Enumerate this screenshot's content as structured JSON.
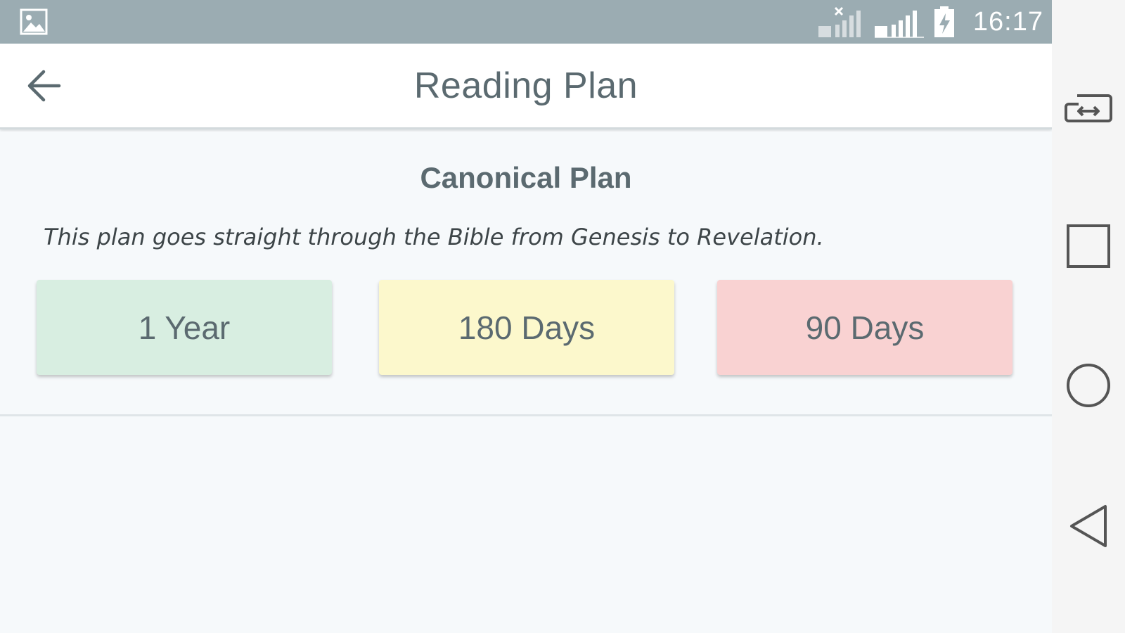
{
  "status_bar": {
    "time": "16:17",
    "icons": [
      "gallery-icon",
      "signal-no-service-icon",
      "signal-2g-icon",
      "battery-charging-icon"
    ],
    "background": "#9bacb2"
  },
  "app_bar": {
    "title": "Reading Plan",
    "back_icon": "arrow-left-icon"
  },
  "plan": {
    "title": "Canonical Plan",
    "description": "This plan goes straight through the Bible from Genesis to Revelation.",
    "options": [
      {
        "label": "1 Year",
        "color": "#d8eee1"
      },
      {
        "label": "180 Days",
        "color": "#fcf8cc"
      },
      {
        "label": "90 Days",
        "color": "#f9d2d2"
      }
    ]
  },
  "nav_bar": {
    "items": [
      "screen-switch-icon",
      "recents-icon",
      "home-icon",
      "back-icon"
    ]
  }
}
